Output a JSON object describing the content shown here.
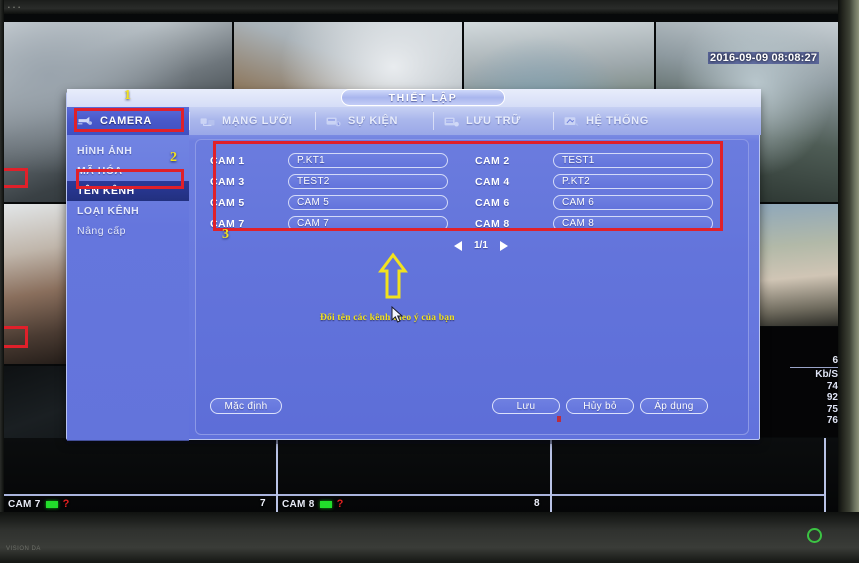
{
  "device": {
    "bezel_logo": "VISION DA",
    "bezel_marking": "• • •",
    "power_led": "power-led-green"
  },
  "live_view": {
    "timestamp": "2016-09-09 08:08:27",
    "bitrate_panel": {
      "top_value": "6",
      "unit_label": "Kb/S",
      "values": [
        "74",
        "92",
        "75",
        "76"
      ]
    },
    "status_channels": [
      {
        "label": "CAM 7",
        "number": "7",
        "rec_indicator": "record-green",
        "alert_indicator": "?"
      },
      {
        "label": "CAM 8",
        "number": "8",
        "rec_indicator": "record-green",
        "alert_indicator": "?"
      }
    ]
  },
  "dialog": {
    "title": "THIẾT LẬP",
    "tabs": [
      {
        "label": "CAMERA",
        "icon": "camera-icon",
        "selected": true
      },
      {
        "label": "MẠNG LƯỚI",
        "icon": "network-icon",
        "selected": false
      },
      {
        "label": "SỰ KIỆN",
        "icon": "event-icon",
        "selected": false
      },
      {
        "label": "LƯU TRỮ",
        "icon": "storage-icon",
        "selected": false
      },
      {
        "label": "HỆ THỐNG",
        "icon": "system-icon",
        "selected": false
      }
    ],
    "sidebar": [
      {
        "label": "HÌNH ẢNH",
        "selected": false
      },
      {
        "label": "MÃ HÓA",
        "selected": false
      },
      {
        "label": "TÊN KÊNH",
        "selected": true
      },
      {
        "label": "LOẠI KÊNH",
        "selected": false
      },
      {
        "label": "Nâng cấp",
        "selected": false
      }
    ],
    "channel_rows": [
      {
        "left_label": "CAM 1",
        "left_value": "P.KT1",
        "right_label": "CAM 2",
        "right_value": "TEST1"
      },
      {
        "left_label": "CAM 3",
        "left_value": "TEST2",
        "right_label": "CAM 4",
        "right_value": "P.KT2"
      },
      {
        "left_label": "CAM 5",
        "left_value": "CAM 5",
        "right_label": "CAM 6",
        "right_value": "CAM 6"
      },
      {
        "left_label": "CAM 7",
        "left_value": "CAM 7",
        "right_label": "CAM 8",
        "right_value": "CAM 8"
      }
    ],
    "pager": {
      "prev_icon": "prev-arrow-icon",
      "page_indicator": "1/1",
      "next_icon": "next-arrow-icon"
    },
    "buttons": {
      "default": "Mặc định",
      "save": "Lưu",
      "cancel": "Hủy bỏ",
      "apply": "Áp dụng"
    }
  },
  "annotations": {
    "step1": "1",
    "step2": "2",
    "step3": "3",
    "caption": "Đổi tên các kênh theo ý của bạn",
    "highlight_color": "#e0202a",
    "marker_color": "#f2e21e"
  }
}
